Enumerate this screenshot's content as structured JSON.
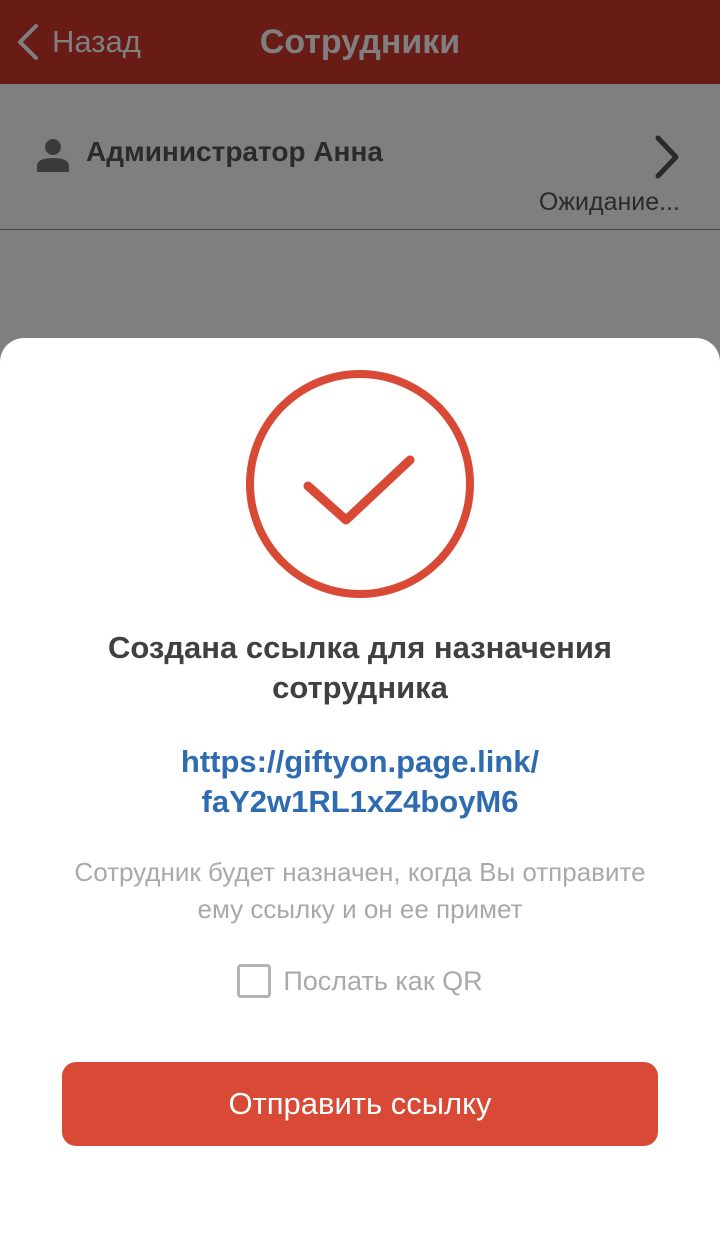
{
  "nav": {
    "back_label": "Назад",
    "title": "Сотрудники"
  },
  "employee": {
    "name": "Администратор Анна",
    "status": "Ожидание...",
    "icons": {
      "person": "person-icon",
      "chevron": "chevron-right-icon"
    }
  },
  "sheet": {
    "icon": "check-circle-icon",
    "title": "Создана ссылка для назначения сотрудника",
    "link_line1": "https://giftyon.page.link/",
    "link_line2": "faY2w1RL1xZ4boyM6",
    "note": "Сотрудник будет назначен, когда Вы отправите ему ссылку и он ее примет",
    "qr_label": "Послать как QR",
    "qr_checked": false,
    "send_label": "Отправить ссылку"
  },
  "colors": {
    "nav_bar": "#d2362a",
    "accent": "#d84a35",
    "link": "#2f6bb0"
  }
}
